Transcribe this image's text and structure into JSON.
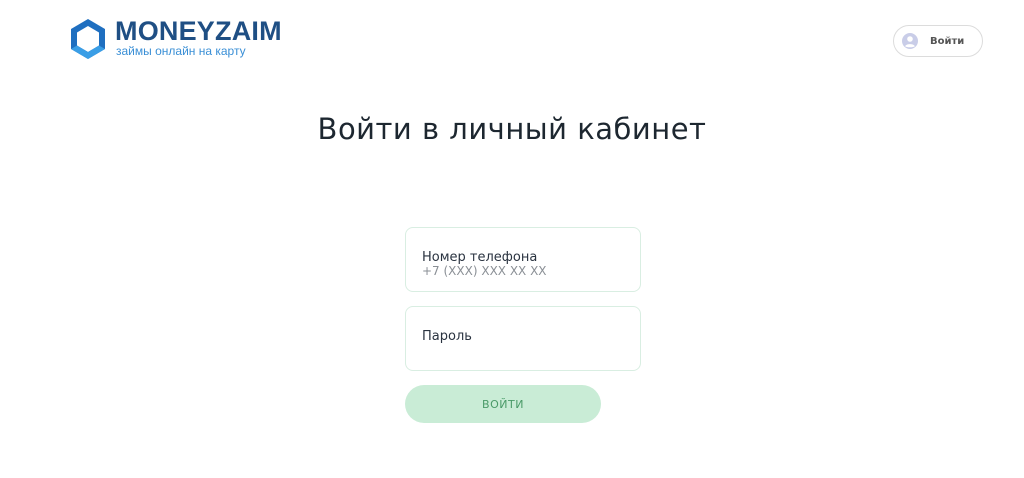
{
  "header": {
    "logo": {
      "name": "MONEYZAIM",
      "tagline": "займы онлайн на карту",
      "icon": "hexagon-logo-icon"
    },
    "login_button": {
      "label": "Войти",
      "icon": "user-icon"
    }
  },
  "main": {
    "title": "Войти в личный кабинет",
    "phone_field": {
      "label": "Номер телефона",
      "placeholder": "+7 (XXX) XXX XX XX",
      "value": ""
    },
    "password_field": {
      "label": "Пароль",
      "placeholder": "",
      "value": ""
    },
    "submit_label": "ВОЙТИ"
  },
  "colors": {
    "brand_dark": "#1f4f84",
    "brand_light": "#3a8fd6",
    "submit_bg": "#c9ecd6",
    "submit_text": "#4a9a68",
    "field_border": "#d9eee2"
  }
}
